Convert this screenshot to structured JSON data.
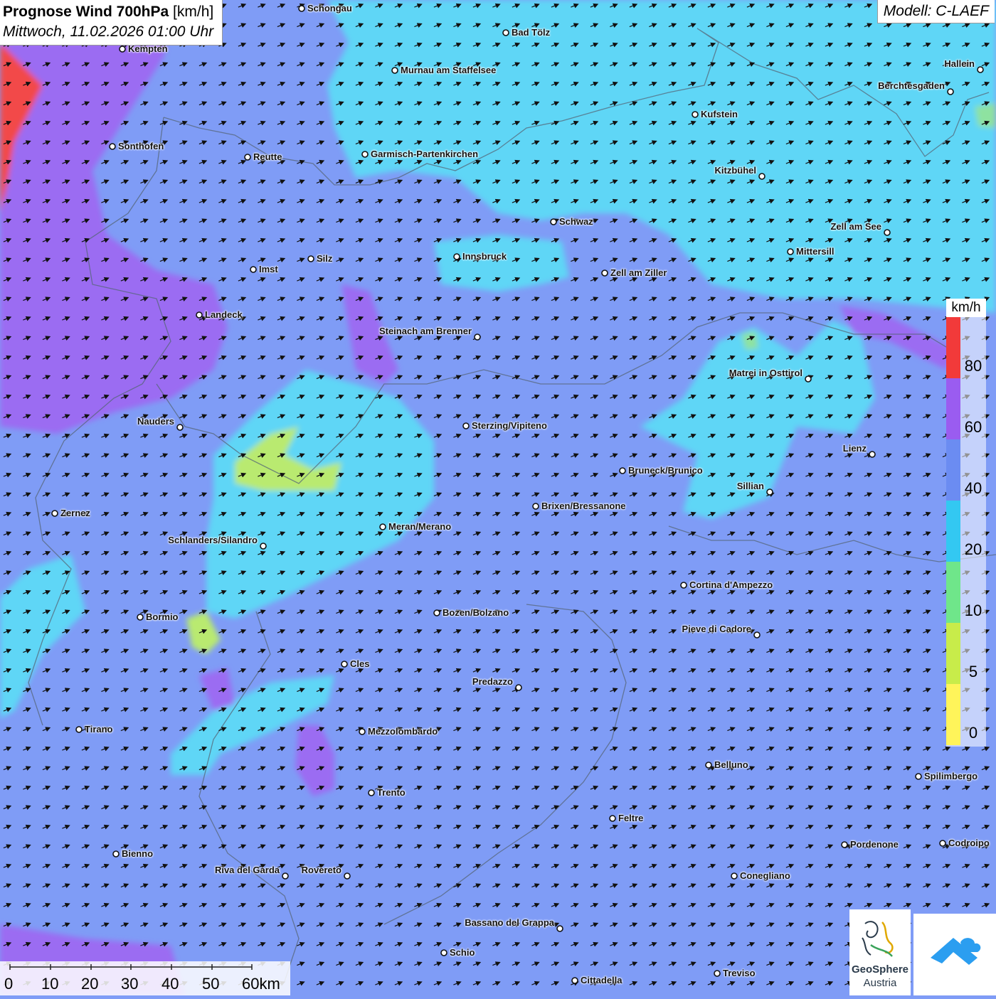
{
  "header": {
    "title_bold": "Prognose Wind 700hPa",
    "title_unit": "[km/h]",
    "datetime": "Mittwoch, 11.02.2026 01:00 Uhr",
    "model": "Modell: C-LAEF"
  },
  "legend": {
    "unit": "km/h",
    "bands": [
      {
        "label": "80",
        "color": "#f23a3a"
      },
      {
        "label": "60",
        "color": "#9a5cf0"
      },
      {
        "label": "40",
        "color": "#6b8cf2"
      },
      {
        "label": "20",
        "color": "#33c8f2"
      },
      {
        "label": "10",
        "color": "#6fe68a"
      },
      {
        "label": "5",
        "color": "#c8ec4a"
      },
      {
        "label": "0",
        "color": "#fff45a"
      }
    ]
  },
  "scale_bar": {
    "labels": [
      "0",
      "10",
      "20",
      "30",
      "40",
      "50",
      "60km"
    ]
  },
  "logos": {
    "geosphere_line1": "GeoSphere",
    "geosphere_line2": "Austria"
  },
  "cities": [
    "Schongau",
    "Bad Tölz",
    "Kempten",
    "Murnau am Staffelsee",
    "Hallein",
    "Berchtesgaden",
    "Kufstein",
    "Sonthofen",
    "Reutte",
    "Garmisch-Partenkirchen",
    "Kitzbühel",
    "Schwaz",
    "Zell am See",
    "Mittersill",
    "Innsbruck",
    "Zell am Ziller",
    "Imst",
    "Silz",
    "Landeck",
    "Steinach am Brenner",
    "Matrei in Osttirol",
    "Nauders",
    "Sterzing/Vipiteno",
    "Lienz",
    "Bruneck/Brunico",
    "Sillian",
    "Zernez",
    "Brixen/Bressanone",
    "Meran/Merano",
    "Schlanders/Silandro",
    "Cortina d'Ampezzo",
    "Bormio",
    "Bozen/Bolzano",
    "Pieve di Cadore",
    "Cles",
    "Predazzo",
    "Tirano",
    "Mezzolombardo",
    "Belluno",
    "Spilimbergo",
    "Trento",
    "Feltre",
    "Pordenone",
    "Codroipo",
    "Bienno",
    "Riva del Garda",
    "Rovereto",
    "Conegliano",
    "Bassano del Grappa",
    "Schio",
    "Treviso",
    "Cittadella"
  ]
}
